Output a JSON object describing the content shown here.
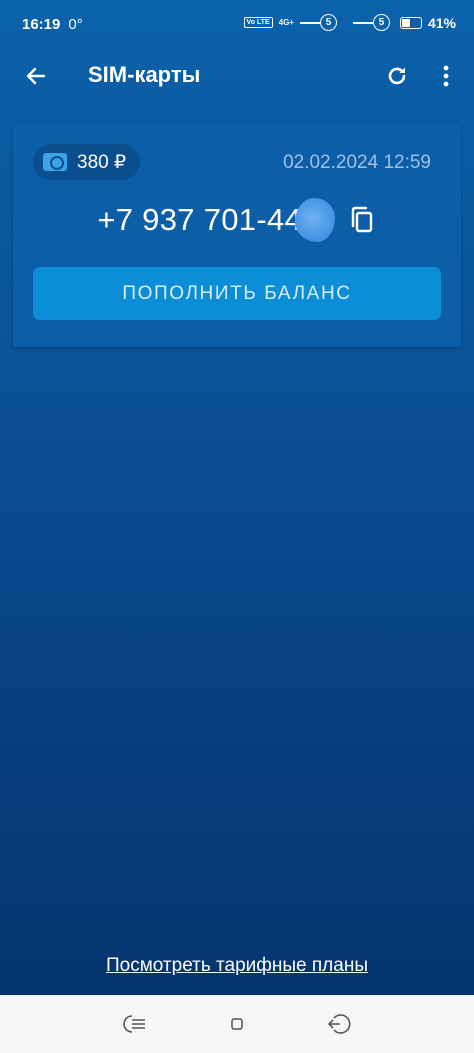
{
  "status_bar": {
    "time": "16:19",
    "temperature": "0°",
    "volte": "Vo LTE",
    "network": "4G+",
    "sim1": "5",
    "sim2": "5",
    "battery": "41%",
    "battery_level": 0.41
  },
  "app_bar": {
    "title": "SIM-карты",
    "back_icon": "arrow-left-icon",
    "refresh_icon": "refresh-icon",
    "more_icon": "more-vertical-icon"
  },
  "sim_card": {
    "balance": "380 ₽",
    "balance_icon": "wallet-icon",
    "date": "02.02.2024 12:59",
    "phone": "+7 937 701-44-",
    "copy_icon": "copy-icon",
    "topup_label": "ПОПОЛНИТЬ БАЛАНС"
  },
  "footer": {
    "tariffs_link": "Посмотреть тарифные планы"
  },
  "nav_bar": {
    "menu_icon": "menu-icon",
    "home_icon": "home-square-icon",
    "back_icon": "back-icon"
  },
  "colors": {
    "background_top": "#0b62ab",
    "background_bottom": "#06336c",
    "card": "#0d5ea9",
    "button": "#0c8ed7",
    "date_text": "#9fc1e2"
  }
}
